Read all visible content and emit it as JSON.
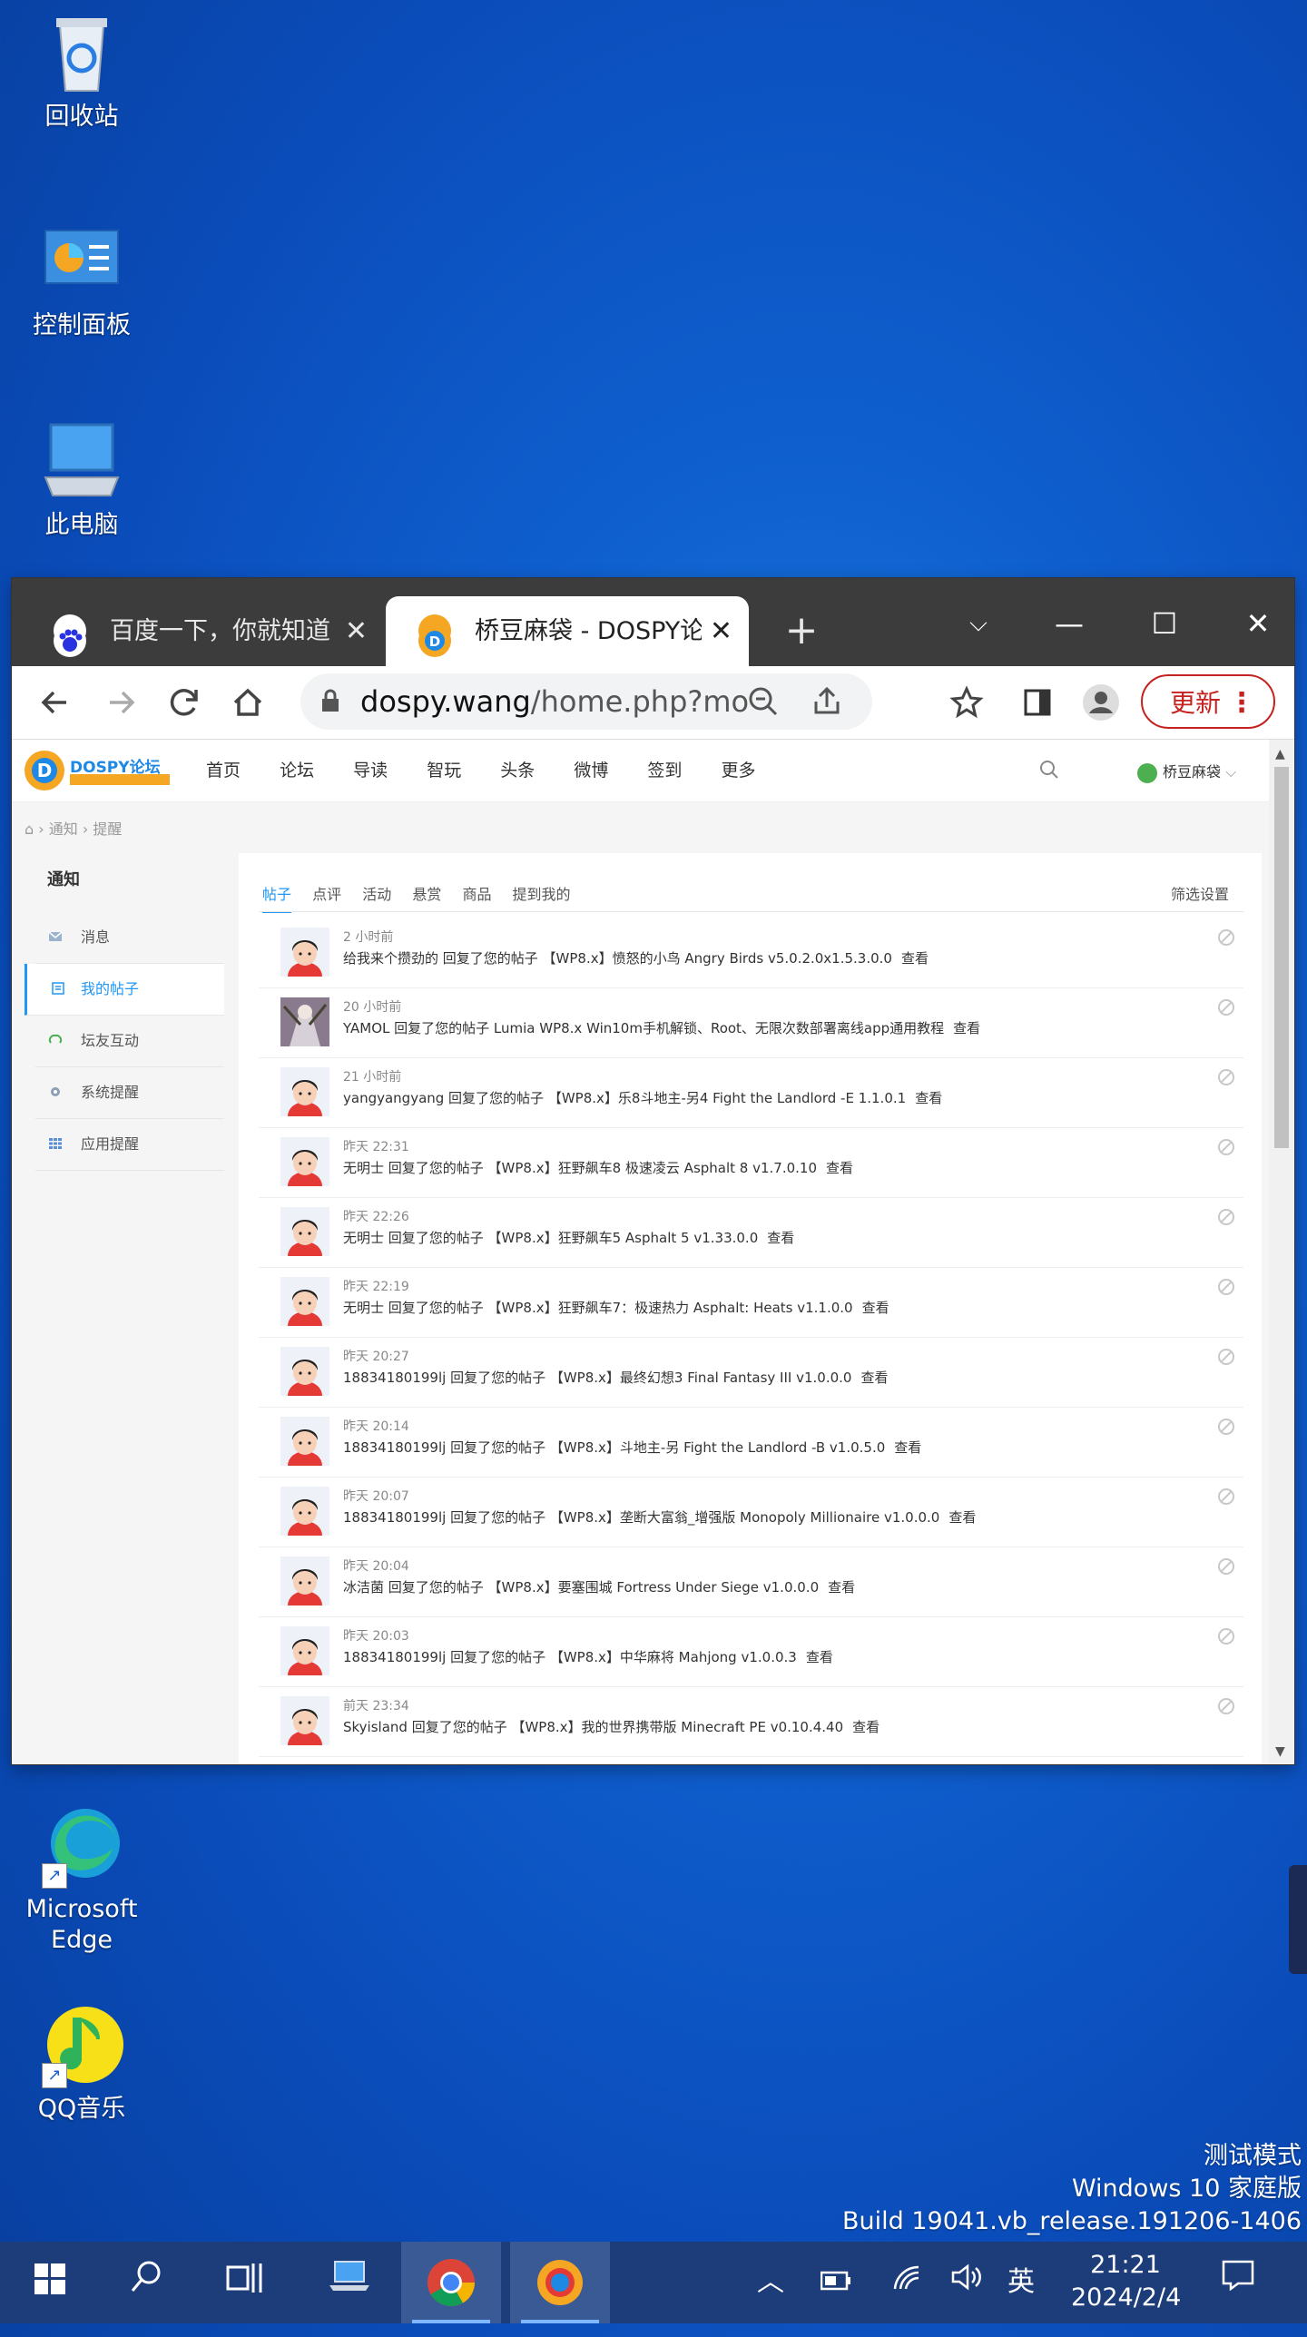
{
  "desktop": {
    "icons": [
      {
        "label": "回收站"
      },
      {
        "label": "控制面板"
      },
      {
        "label": "此电脑"
      },
      {
        "label": "Microsoft Edge"
      },
      {
        "label": "QQ音乐"
      }
    ],
    "watermark": [
      "测试模式",
      "Windows 10 家庭版",
      "Build 19041.vb_release.191206-1406"
    ]
  },
  "browser": {
    "tabs": [
      {
        "title": "百度一下，你就知道",
        "close": "✕"
      },
      {
        "title": "桥豆麻袋 - DOSPY论坛",
        "close": "✕"
      }
    ],
    "new_tab": "+",
    "window_controls": {
      "minimize": "—",
      "maximize": "☐",
      "close": "✕"
    },
    "url_host": "dospy.wang",
    "url_path": "/home.php?mod...",
    "update_label": "更新",
    "menu_dots": "⋮"
  },
  "site": {
    "logo_text": "DOSPY论坛",
    "nav": [
      "首页",
      "论坛",
      "导读",
      "智玩",
      "头条",
      "微博",
      "签到",
      "更多"
    ],
    "username": "桥豆麻袋",
    "breadcrumb": [
      "通知",
      "提醒"
    ],
    "sidebar": {
      "title": "通知",
      "items": [
        "消息",
        "我的帖子",
        "坛友互动",
        "系统提醒",
        "应用提醒"
      ]
    },
    "tabs": [
      "帖子",
      "点评",
      "活动",
      "悬赏",
      "商品",
      "提到我的"
    ],
    "filter_label": "筛选设置",
    "view_label": "查看",
    "notifications": [
      {
        "time": "2 小时前",
        "text": "给我来个攒劲的 回复了您的帖子 【WP8.x】愤怒的小鸟 Angry Birds v5.0.2.0x1.5.3.0.0"
      },
      {
        "time": "20 小时前",
        "text": "YAMOL 回复了您的帖子 Lumia WP8.x Win10m手机解锁、Root、无限次数部署离线app通用教程"
      },
      {
        "time": "21 小时前",
        "text": "yangyangyang 回复了您的帖子 【WP8.x】乐8斗地主-另4 Fight the Landlord -E 1.1.0.1"
      },
      {
        "time": "昨天 22:31",
        "text": "无明士 回复了您的帖子 【WP8.x】狂野飙车8 极速凌云 Asphalt 8 v1.7.0.10"
      },
      {
        "time": "昨天 22:26",
        "text": "无明士 回复了您的帖子 【WP8.x】狂野飙车5 Asphalt 5 v1.33.0.0"
      },
      {
        "time": "昨天 22:19",
        "text": "无明士 回复了您的帖子 【WP8.x】狂野飙车7：极速热力 Asphalt: Heats v1.1.0.0"
      },
      {
        "time": "昨天 20:27",
        "text": "18834180199lj 回复了您的帖子 【WP8.x】最终幻想3 Final Fantasy III v1.0.0.0"
      },
      {
        "time": "昨天 20:14",
        "text": "18834180199lj 回复了您的帖子 【WP8.x】斗地主-另 Fight the Landlord -B v1.0.5.0"
      },
      {
        "time": "昨天 20:07",
        "text": "18834180199lj 回复了您的帖子 【WP8.x】垄断大富翁_增强版 Monopoly Millionaire v1.0.0.0"
      },
      {
        "time": "昨天 20:04",
        "text": "冰洁菌 回复了您的帖子 【WP8.x】要塞围城 Fortress Under Siege v1.0.0.0"
      },
      {
        "time": "昨天 20:03",
        "text": "18834180199lj 回复了您的帖子 【WP8.x】中华麻将 Mahjong v1.0.0.3"
      },
      {
        "time": "前天 23:34",
        "text": "Skyisland 回复了您的帖子 【WP8.x】我的世界携带版 Minecraft PE v0.10.4.40"
      }
    ]
  },
  "taskbar": {
    "ime": "英",
    "time": "21:21",
    "date": "2024/2/4"
  }
}
